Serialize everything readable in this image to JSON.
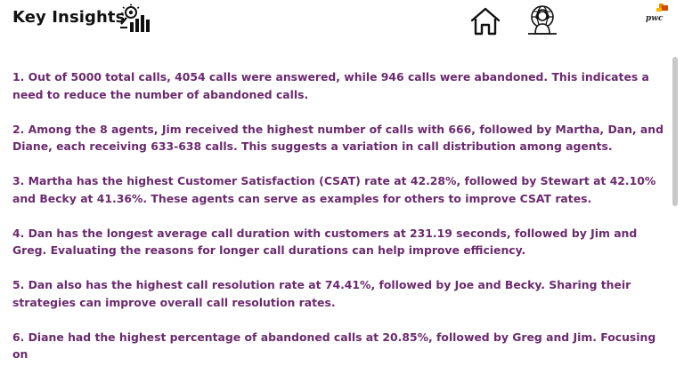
{
  "header": {
    "title": "Key Insights",
    "icons": [
      "insight-analytics-icon",
      "home-icon",
      "global-support-icon"
    ],
    "brand_text": "pwc",
    "brand_colors": [
      "#d04a02",
      "#eb8c00",
      "#ffb600"
    ]
  },
  "insights": [
    "1. Out of 5000 total calls, 4054 calls were answered, while 946 calls were abandoned. This indicates a need to reduce the number of abandoned calls.",
    "2. Among the 8 agents, Jim received the highest number of calls with 666, followed by Martha, Dan, and Diane, each receiving 633-638 calls. This suggests a variation in call distribution among agents.",
    "3. Martha has the highest Customer Satisfaction (CSAT) rate at 42.28%, followed by Stewart at 42.10% and Becky at 41.36%. These agents can serve as examples for others to improve CSAT rates.",
    "4. Dan has the longest average call duration with customers at 231.19 seconds, followed by Jim and Greg. Evaluating the reasons for longer call durations can help improve efficiency.",
    "5. Dan also has the highest call resolution rate at 74.41%, followed by Joe and Becky. Sharing their strategies can improve overall call resolution rates.",
    "6. Diane had the highest percentage of abandoned calls at 20.85%, followed by Greg and Jim. Focusing on"
  ],
  "colors": {
    "insight_text": "#6b2a6e",
    "title_text": "#111111",
    "scrollbar": "#c8c8c8"
  }
}
